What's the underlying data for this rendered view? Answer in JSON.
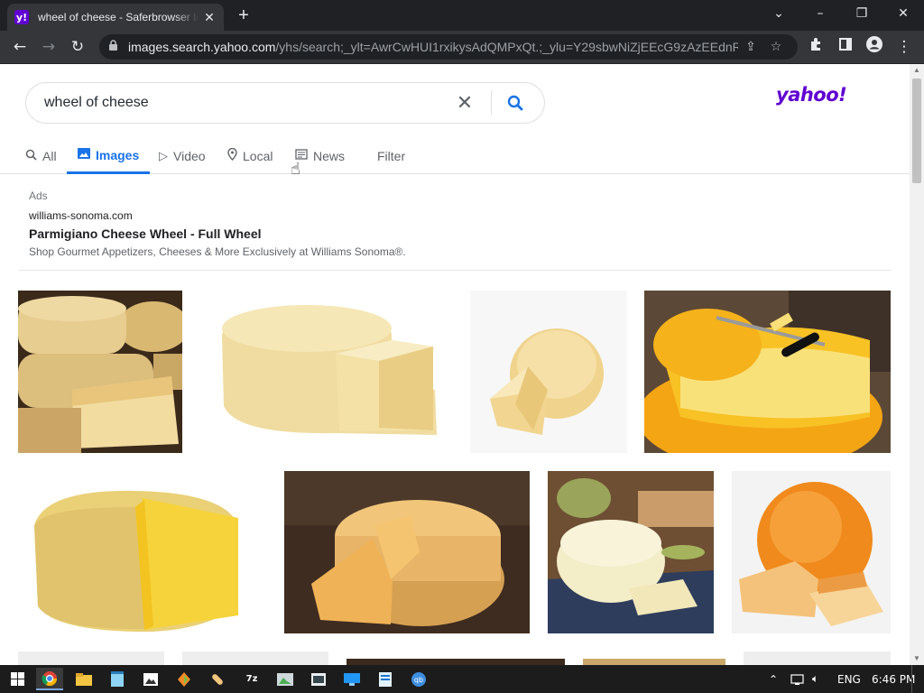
{
  "browser": {
    "tab_title": "wheel of cheese - Saferbrowser Ir",
    "favicon_text": "y!",
    "close_tab": "✕",
    "new_tab": "+",
    "url_host": "images.search.yahoo.com",
    "url_rest": "/yhs/search;_ylt=AwrCwHUI1rxikysAdQMPxQt.;_ylu=Y29sbwNiZjEEcG9zAzEEdnRp..."
  },
  "search": {
    "query": "wheel of cheese",
    "clear_label": "✕"
  },
  "logo": "yahoo!",
  "nav_tabs": [
    {
      "label": "All",
      "icon": "search-icon"
    },
    {
      "label": "Images",
      "icon": "image-icon"
    },
    {
      "label": "Video",
      "icon": "play-icon"
    },
    {
      "label": "Local",
      "icon": "location-icon"
    },
    {
      "label": "News",
      "icon": "newspaper-icon"
    },
    {
      "label": "Filter",
      "icon": ""
    }
  ],
  "ad": {
    "label": "Ads",
    "domain": "williams-sonoma.com",
    "title": "Parmigiano Cheese Wheel - Full Wheel",
    "description": "Shop Gourmet Appetizers, Cheeses & More Exclusively at Williams Sonoma®."
  },
  "results": [
    {
      "subject": "stacked aged cheese wheels"
    },
    {
      "subject": "pale cheese wheel with cut wedge"
    },
    {
      "subject": "small cheese wheel with wedge"
    },
    {
      "subject": "yellow gouda wheel with knife"
    },
    {
      "subject": "yellow cheese wheel cut open"
    },
    {
      "subject": "cheese wheel on wooden table"
    },
    {
      "subject": "cheese board with sandwich"
    },
    {
      "subject": "orange wax gouda wheel with slices"
    }
  ],
  "taskbar": {
    "language": "ENG",
    "time": "6:46 PM"
  },
  "colors": {
    "accent": "#1a73e8",
    "yahoo": "#6001d2",
    "chrome_dark": "#35363a"
  }
}
